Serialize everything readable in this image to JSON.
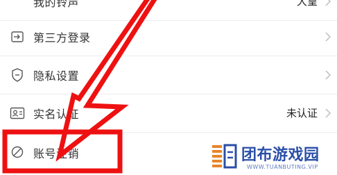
{
  "settings": {
    "items": [
      {
        "label": "我的铃声",
        "value": "大皇",
        "icon": "bell-icon"
      },
      {
        "label": "第三方登录",
        "value": "",
        "icon": "link-icon"
      },
      {
        "label": "隐私设置",
        "value": "",
        "icon": "shield-icon"
      },
      {
        "label": "实名认证",
        "value": "未认证",
        "icon": "id-card-icon"
      },
      {
        "label": "账号注销",
        "value": "",
        "icon": "forbidden-icon"
      }
    ]
  },
  "annotation": {
    "color": "#ee1111",
    "shapes": [
      "arrow",
      "highlight-box"
    ]
  },
  "watermark": {
    "name": "团布游戏园",
    "url": "WWW.TUANBUTING.VIP",
    "color": "#2a4fa8"
  }
}
